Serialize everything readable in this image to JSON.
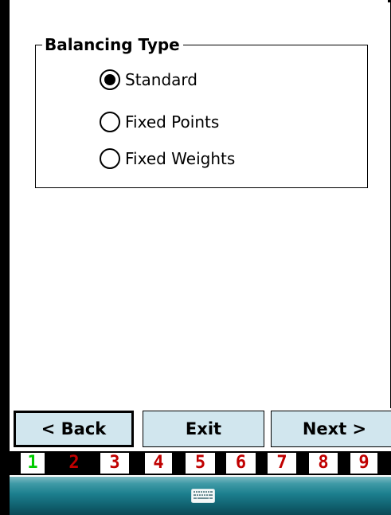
{
  "group": {
    "title": "Balancing Type",
    "options": [
      {
        "label": "Standard",
        "selected": true
      },
      {
        "label": "Fixed Points",
        "selected": false
      },
      {
        "label": "Fixed Weights",
        "selected": false
      }
    ]
  },
  "buttons": {
    "back": "< Back",
    "exit": "Exit",
    "next": "Next >"
  },
  "pages": {
    "items": [
      "1",
      "2",
      "3",
      "4",
      "5",
      "6",
      "7",
      "8",
      "9"
    ],
    "current": "2",
    "visited": [
      "1"
    ]
  },
  "taskbar": {
    "icon": "keyboard-icon"
  },
  "colors": {
    "button_bg": "#d1e6ee",
    "page_number": "#c00000",
    "page_visited": "#00cc00",
    "taskbar": "#1c7f8e"
  }
}
